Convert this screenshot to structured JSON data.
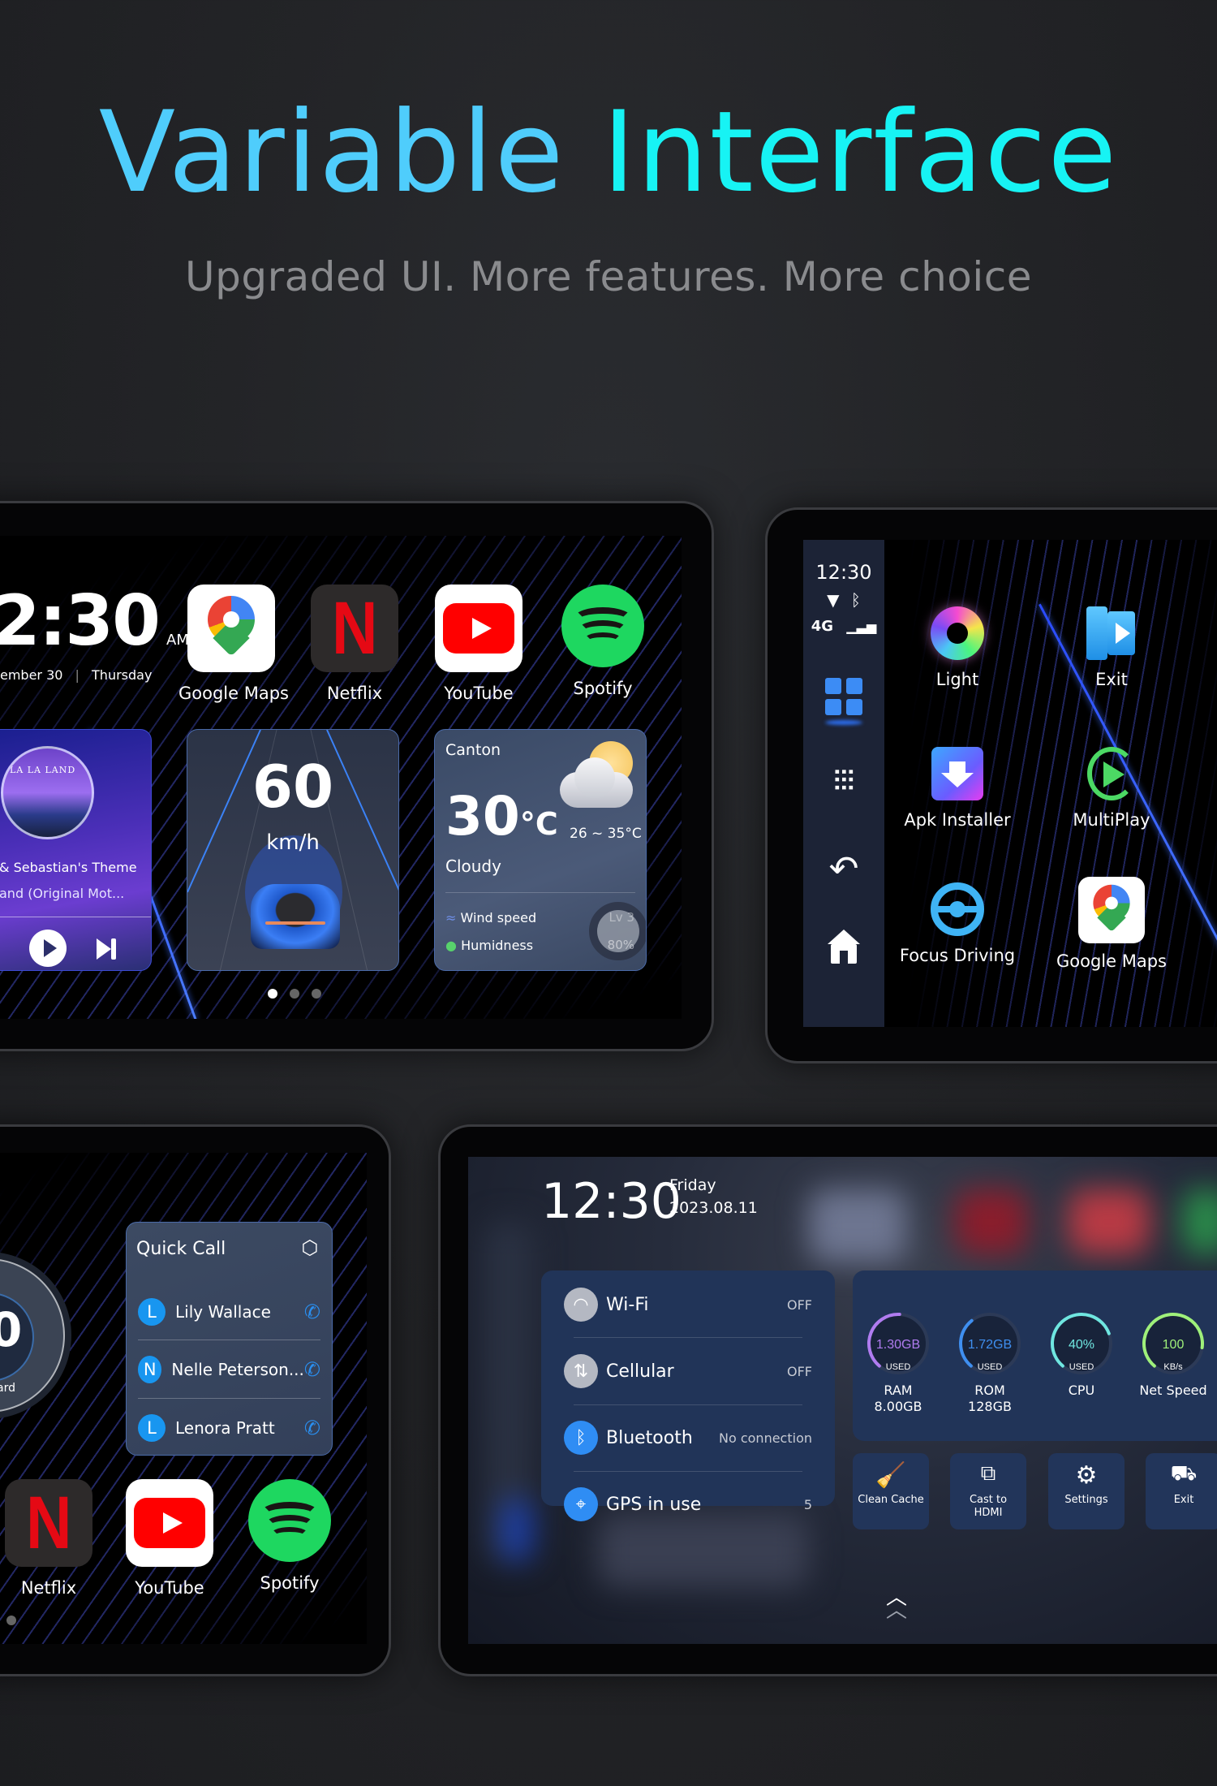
{
  "hero": {
    "title_part1": "Variable",
    "title_part2": "Interface",
    "subtitle": "Upgraded UI. More features. More choice",
    "colors": {
      "title_part1": "#4fcdfc",
      "title_part2": "#17f3f4",
      "subtitle": "#8a8b8e"
    }
  },
  "screen_home": {
    "clock": {
      "time": "2:30",
      "ampm": "AM",
      "date": "ember 30",
      "weekday": "Thursday"
    },
    "apps": [
      {
        "label": "Google Maps",
        "icon": "google-maps-icon"
      },
      {
        "label": "Netflix",
        "icon": "netflix-icon"
      },
      {
        "label": "YouTube",
        "icon": "youtube-icon"
      },
      {
        "label": "Spotify",
        "icon": "spotify-icon"
      }
    ],
    "music": {
      "album_art_text": "LA LA LAND",
      "track": "& Sebastian's Theme",
      "album": "and (Original Mot...",
      "play_icon": "play-icon",
      "next_icon": "skip-next-icon"
    },
    "speed": {
      "value": "60",
      "unit": "km/h"
    },
    "weather": {
      "city": "Canton",
      "temp": "30",
      "temp_unit": "°C",
      "range": "26 ~ 35°C",
      "condition": "Cloudy",
      "wind_label": "Wind speed",
      "wind_value": "Lv 3",
      "humidity_label": "Humidness",
      "humidity_value": "80%"
    },
    "page_dots": {
      "count": 3,
      "active": 1
    }
  },
  "screen_launcher": {
    "status": {
      "time": "12:30",
      "network": "4G"
    },
    "sidebar": [
      {
        "name": "apps-grid",
        "icon": "apps-grid-icon",
        "active": true
      },
      {
        "name": "equalizer",
        "icon": "sliders-icon",
        "active": false
      },
      {
        "name": "back",
        "icon": "back-icon",
        "active": false
      },
      {
        "name": "home",
        "icon": "home-icon",
        "active": false
      }
    ],
    "apps": [
      {
        "label": "Light",
        "icon": "color-wheel-icon"
      },
      {
        "label": "Exit",
        "icon": "exit-door-icon"
      },
      {
        "label": "Apk Installer",
        "icon": "apk-installer-icon"
      },
      {
        "label": "MultiPlay",
        "icon": "multiplay-icon"
      },
      {
        "label": "Focus Driving",
        "icon": "steering-wheel-icon"
      },
      {
        "label": "Google Maps",
        "icon": "google-maps-icon"
      }
    ]
  },
  "screen_quickcall": {
    "gauge_label": "ard",
    "gauge_value": "0",
    "quick_call": {
      "title": "Quick Call",
      "contacts": [
        {
          "initial": "L",
          "name": "Lily Wallace"
        },
        {
          "initial": "N",
          "name": "Nelle Peterson..."
        },
        {
          "initial": "L",
          "name": "Lenora Pratt"
        }
      ]
    },
    "apps": [
      {
        "label": "Netflix",
        "icon": "netflix-icon"
      },
      {
        "label": "YouTube",
        "icon": "youtube-icon"
      },
      {
        "label": "Spotify",
        "icon": "spotify-icon"
      }
    ]
  },
  "screen_control": {
    "time": "12:30",
    "weekday": "Friday",
    "date": "2023.08.11",
    "toggles": [
      {
        "label": "Wi-Fi",
        "value": "OFF",
        "icon": "wifi-icon",
        "active": false
      },
      {
        "label": "Cellular",
        "value": "OFF",
        "icon": "cellular-data-icon",
        "active": false
      },
      {
        "label": "Bluetooth",
        "value": "No connection",
        "icon": "bluetooth-icon",
        "active": true
      },
      {
        "label": "GPS in use",
        "value": "5",
        "icon": "gps-icon",
        "active": true
      }
    ],
    "gauges": [
      {
        "value": "1.30GB",
        "sub": "USED",
        "name": "RAM",
        "detail": "8.00GB",
        "fraction": 0.16,
        "color": "#b07cf0"
      },
      {
        "value": "1.72GB",
        "sub": "USED",
        "name": "ROM",
        "detail": "128GB",
        "fraction": 0.013,
        "color": "#3f8ff0"
      },
      {
        "value": "40%",
        "sub": "USED",
        "name": "CPU",
        "detail": "",
        "fraction": 0.4,
        "color": "#6fe6e0"
      },
      {
        "value": "100",
        "sub": "KB/s",
        "name": "Net Speed",
        "detail": "",
        "fraction": 0.5,
        "color": "#9ff07a"
      }
    ],
    "tiles": [
      {
        "label": "Clean Cache",
        "icon": "broom-icon",
        "glyph": "⌂"
      },
      {
        "label": "Cast to HDMI",
        "icon": "cast-hdmi-icon",
        "glyph": "⧉"
      },
      {
        "label": "Settings",
        "icon": "gear-icon",
        "glyph": "⚙"
      },
      {
        "label": "Exit",
        "icon": "car-icon",
        "glyph": "🚘"
      }
    ],
    "swipe_up_icon": "double-chevron-up-icon"
  }
}
